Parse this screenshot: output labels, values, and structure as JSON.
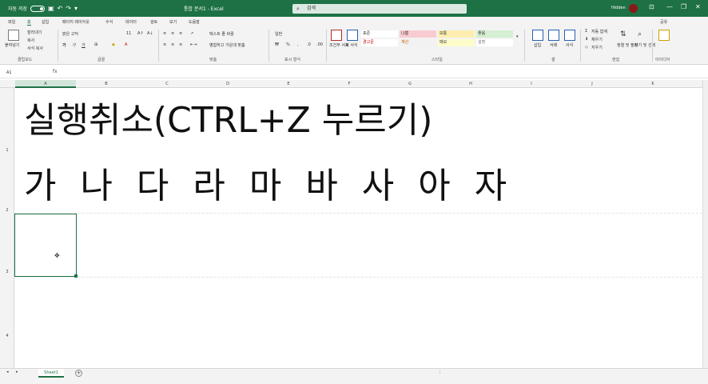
{
  "titlebar": {
    "autosave_label": "자동 저장",
    "title": "통합 문서1 - Excel",
    "search_placeholder": "검색",
    "user": "Hidden",
    "minimize": "—",
    "restore": "❐",
    "close": "✕"
  },
  "tabs": [
    "파일",
    "홈",
    "삽입",
    "페이지 레이아웃",
    "수식",
    "데이터",
    "검토",
    "보기",
    "도움말"
  ],
  "active_tab": "홈",
  "share_label": "공유",
  "ribbon": {
    "clipboard": {
      "paste": "붙여넣기",
      "cut": "잘라내기",
      "copy": "복사",
      "format_painter": "서식 복사",
      "label": "클립보드"
    },
    "font": {
      "name": "맑은 고딕",
      "size": "11",
      "bold": "가",
      "italic": "가",
      "underline": "가",
      "label": "글꼴"
    },
    "alignment": {
      "wrap": "텍스트 줄 바꿈",
      "merge": "병합하고 가운데 맞춤",
      "label": "맞춤"
    },
    "number": {
      "format": "일반",
      "percent": "%",
      "label": "표시 형식"
    },
    "styles": {
      "conditional": "조건부 서식",
      "table": "표 서식",
      "cells": [
        {
          "text": "표준",
          "bg": "#ffffff"
        },
        {
          "text": "나쁨",
          "bg": "#f8cbd3"
        },
        {
          "text": "보통",
          "bg": "#fdeeb0"
        },
        {
          "text": "좋음",
          "bg": "#d5efd2"
        },
        {
          "text": "경고문",
          "bg": "#ffffff"
        },
        {
          "text": "계산",
          "bg": "#f2f2f2"
        },
        {
          "text": "메모",
          "bg": "#fffccc"
        },
        {
          "text": "설명",
          "bg": "#ffffff"
        }
      ],
      "label": "스타일"
    },
    "cells": {
      "insert": "삽입",
      "delete": "삭제",
      "format": "서식",
      "label": "셀"
    },
    "editing": {
      "autosum": "자동 합계",
      "fill": "채우기",
      "clear": "지우기",
      "sort": "정렬 및 필터",
      "find": "찾기 및 선택",
      "label": "편집"
    },
    "ideas": {
      "label": "아이디어"
    }
  },
  "formula": {
    "namebox": "A1",
    "fx": "fx",
    "value": ""
  },
  "columns": [
    "A",
    "B",
    "C",
    "D",
    "E",
    "F",
    "G",
    "H",
    "I",
    "J",
    "K"
  ],
  "rows": [
    "1",
    "2",
    "3",
    "4"
  ],
  "cell_text": {
    "line1": "실행취소(CTRL+Z 누르기)",
    "line2": "가 나 다 라 마 바 사 아 자"
  },
  "sheet": {
    "name": "Sheet1",
    "add": "+"
  },
  "colors": {
    "excel_green": "#1e7145"
  }
}
